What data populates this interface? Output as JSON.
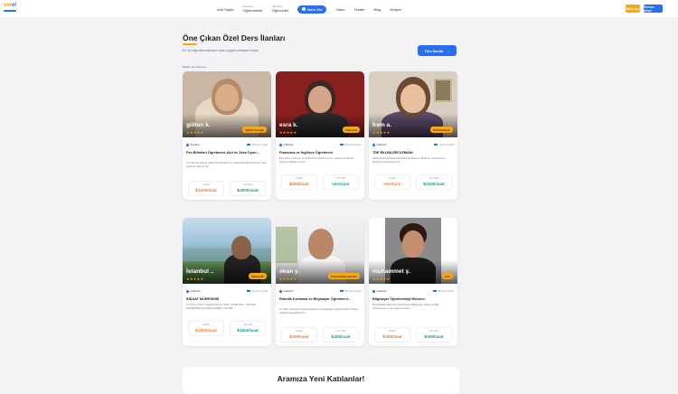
{
  "nav": {
    "logo_a": "ver",
    "logo_b": "el",
    "links": [
      {
        "pre": "",
        "label": "Ana Sayfa"
      },
      {
        "pre": "Özel Ders",
        "label": "Öğretmenler"
      },
      {
        "pre": "Özel Ders",
        "label": "Öğrenciler"
      },
      {
        "pre": "",
        "label": "Ders Ver"
      },
      {
        "pre": "",
        "label": "Video"
      },
      {
        "pre": "",
        "label": "Testler"
      },
      {
        "pre": "",
        "label": "Blog"
      },
      {
        "pre": "",
        "label": "İletişim"
      }
    ],
    "login": "Giriş Yap",
    "signup": "Hemen Kayıt"
  },
  "section": {
    "title": "Öne Çıkan Özel Ders İlanları",
    "subtitle": "En iyi öğretmenlerden size uygun dersleri bulun",
    "hint": "Başlık, ilan görmek ↓",
    "all_button": "Tüm İlanlar"
  },
  "cards": [
    {
      "name": "gülten k.",
      "badge": "Eğitim Koçluğu",
      "city": "Ankara",
      "lessons": "15 ders verdi",
      "title": "Fen Bilimleri Öğretmeni, Akıl ve Zeka Oyun...",
      "desc": "10 yıllık deneyime sahip fen bilimleri ve matematik öğretmeniyim. Her kademe öğrenci ile...",
      "online_label": "Online",
      "online_price": "₺1000/saat",
      "face_label": "Yüz Yüze",
      "face_price": "₺2000/saat",
      "stars": "★★★★★"
    },
    {
      "name": "esra k.",
      "badge": "Fransızca",
      "city": "İstanbul",
      "lessons": "25 ders verdi",
      "title": "Fransızca ve İngilizce Öğretmeni",
      "desc": "Ben Esra, İngilizce ve Fransızca öğretmeniyim. Teach Certificate belgesi aldıktan sonra...",
      "online_label": "Online",
      "online_price": "₺500/saat",
      "face_label": "Yüz Yüze",
      "face_price": "vermiyor",
      "stars": "★★★★★"
    },
    {
      "name": "İrem a.",
      "badge": "Türk Edebiyatı",
      "city": "İstanbul",
      "lessons": "3 ders verdi",
      "title": "TDE EKLİNLERİ UZMANI",
      "desc": "İstanbul Üniversitesi Dil Edebiyat Bölümü. Bölümü mezunuyum, İstanbul Üniversitesi Dil...",
      "online_label": "Online",
      "online_price": "vermiyor",
      "face_label": "Yüz Yüze",
      "face_price": "₺1000/saat",
      "stars": "★★★★★"
    },
    {
      "name": "İstanbul ..",
      "badge": "Matematik",
      "city": "İstanbul",
      "lessons": "11 ders verdi",
      "title": "İNŞAAT MÜHENDİSİ",
      "desc": "3 YKS/TYT/AYT GEÇİŞ KAYIT / MSÜ YE BİLGİSİ... EĞİTİM MÜHENDİSİ OLARAK GÖREV YAPTIM...",
      "online_label": "Online",
      "online_price": "₺1000/saat",
      "face_label": "Yüz Yüze",
      "face_price": "₺1500/saat",
      "stars": "★★★★★"
    },
    {
      "name": "okan y.",
      "badge": "Programlama Dersleri",
      "city": "İstanbul",
      "lessons": "45 ders verdi",
      "title": "Robotik Kodlama ve Bilgisayar Öğretmeni...",
      "desc": "10 yıllık tecrübeli robotik kodlama ve bilgisayar öğretmeniyim. Birçok okulda çalışmaktayım...",
      "online_label": "Online",
      "online_price": "₺400/saat",
      "face_label": "Yüz Yüze",
      "face_price": "₺400/saat",
      "stars": "★★★★★"
    },
    {
      "name": "muhammet ş.",
      "badge": "Java",
      "city": "İstanbul",
      "lessons": "48 ders verdi",
      "title": "Bilgisayar Öğretmenliği Mezunu",
      "desc": "Merhabalar Marmara Üniversitesi Bilgisayar Öğretmenliği mezunuyum. 3 yılı aşkındır özel...",
      "online_label": "Online",
      "online_price": "₺400/saat",
      "face_label": "Yüz Yüze",
      "face_price": "₺400/saat",
      "stars": "★★★★★"
    }
  ],
  "join": {
    "title": "Aramıza Yeni Katılanlar!"
  },
  "colors": {
    "accent": "#2a6ef0",
    "orange": "#f5a817",
    "online_price": "#f07a30",
    "face_price": "#15a08a"
  }
}
